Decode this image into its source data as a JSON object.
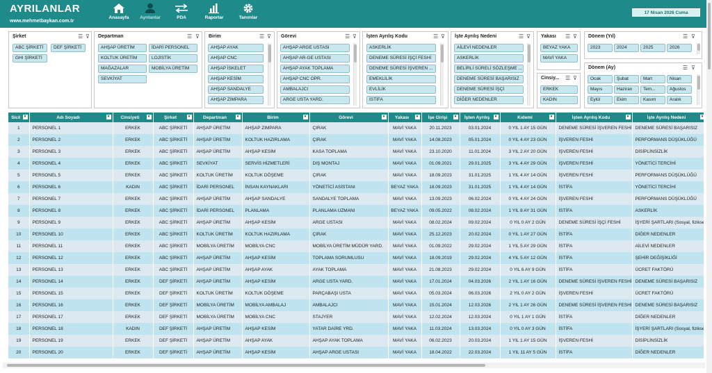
{
  "header": {
    "title": "AYRILANLAR",
    "website": "www.mehmetbaykan.com.tr",
    "date": "17 Nisan 2026 Cuma",
    "nav": [
      {
        "label": "Anasayfa",
        "icon": "home-icon"
      },
      {
        "label": "Ayrılanlar",
        "icon": "user-icon"
      },
      {
        "label": "PDA",
        "icon": "arrows-icon"
      },
      {
        "label": "Raporlar",
        "icon": "bar-chart-icon"
      },
      {
        "label": "Tanımlar",
        "icon": "gear-icon"
      }
    ]
  },
  "slicers": {
    "sirket": {
      "title": "Şirket",
      "items": [
        "ABC ŞİRKETİ",
        "DEF ŞİRKETİ",
        "GHI ŞİRKETİ"
      ]
    },
    "departman": {
      "title": "Departman",
      "items": [
        "AHŞAP ÜRETİM",
        "İDARİ PERSONEL",
        "KOLTUK ÜRETİM",
        "LOJİSTİK",
        "MAĞAZALAR",
        "MOBİLYA ÜRETİM",
        "SEVKİYAT"
      ]
    },
    "birim": {
      "title": "Birim",
      "items": [
        "AHŞAP AYAK",
        "AHŞAP CNC",
        "AHŞAP İSKELET",
        "AHŞAP KESİM",
        "AHŞAP SANDALYE",
        "AHŞAP ZIMPARA"
      ]
    },
    "gorevi": {
      "title": "Görevi",
      "items": [
        "AHŞAP ARGE USTASI",
        "AHŞAP AR-GE USTASI",
        "AHŞAP AYAK TOPLAMA",
        "AHŞAP CNC OPR.",
        "AMBALAJCI",
        "ARGE USTA YARD."
      ]
    },
    "istenAyrilisKodu": {
      "title": "İşten Ayrılış Kodu",
      "items": [
        "ASKERLİK",
        "DENEME SÜRESİ İŞÇİ FESHİ",
        "DENEME SÜRESİ İŞVEREN ...",
        "EMEKLİLİK",
        "EVLİLİK",
        "İSTİFA"
      ]
    },
    "isteAyrilisNedeni": {
      "title": "İşte Ayrılış Nedeni",
      "items": [
        "AİLEVİ NEDENLER",
        "ASKERLİK",
        "BELİRLİ SÜRELİ SÖZLEŞME ...",
        "DENEME SÜRESİ BAŞARISIZ",
        "DENEME SÜRESİ İŞÇİ",
        "DİĞER NEDENLER"
      ]
    },
    "yakasi": {
      "title": "Yakası",
      "items": [
        "BEYAZ YAKA",
        "MAVİ YAKA"
      ]
    },
    "cinsiyet": {
      "title": "Cinsiy...",
      "items": [
        "ERKEK",
        "KADIN"
      ]
    },
    "donemYil": {
      "title": "Dönem (Yıl)",
      "items": [
        "2023",
        "2024",
        "2025",
        "2026"
      ]
    },
    "donemAy": {
      "title": "Dönem (Ay)",
      "items": [
        "Ocak",
        "Şubat",
        "Mart",
        "Nisan",
        "Mayıs",
        "Haziran",
        "Tem...",
        "Ağustos",
        "Eylül",
        "Ekim",
        "Kasım",
        "Aralık"
      ]
    }
  },
  "table": {
    "columns": [
      "Sicil",
      "Adı Soyadı",
      "Cinsiyeti",
      "Şirket",
      "Departman",
      "Birim",
      "Görevi",
      "Yakası",
      "İşe Girişi",
      "İşten Ayrılış",
      "Kıdemi",
      "İşten Ayrılış Kodu",
      "İşte Ayrılış Nedeni"
    ],
    "rows": [
      [
        "1",
        "PERSONEL 1",
        "ERKEK",
        "ABC ŞİRKETİ",
        "AHŞAP ÜRETİM",
        "AHŞAP ZIMPARA",
        "ÇIRAK",
        "MAVİ YAKA",
        "20.11.2023",
        "03.01.2024",
        "0 YIL 1 AY 15 GÜN",
        "DENEME SÜRESİ İŞVEREN FESHİ",
        "DENEME SÜRESİ BAŞARISIZ"
      ],
      [
        "2",
        "PERSONEL 2",
        "ERKEK",
        "ABC ŞİRKETİ",
        "AHŞAP ÜRETİM",
        "KOLTUK HAZIRLAMA",
        "ÇIRAK",
        "MAVİ YAKA",
        "14.08.2023",
        "05.01.2024",
        "0 YIL 4 AY 23 GÜN",
        "İŞVEREN FESHİ",
        "PERFORMANS DÜŞÜKLÜĞÜ"
      ],
      [
        "3",
        "PERSONEL 3",
        "ERKEK",
        "ABC ŞİRKETİ",
        "AHŞAP ÜRETİM",
        "AHŞAP KESİM",
        "KASA TOPLAMA",
        "MAVİ YAKA",
        "23.10.2020",
        "11.01.2024",
        "3 YIL 2 AY 20 GÜN",
        "İŞVEREN FESHİ",
        "DİSİPLİNSİZLİK"
      ],
      [
        "4",
        "PERSONEL 4",
        "ERKEK",
        "ABC ŞİRKETİ",
        "SEVKİYAT",
        "SERVİS HİZMETLERİ",
        "DIŞ MONTAJ",
        "MAVİ YAKA",
        "01.09.2021",
        "29.01.2025",
        "3 YIL 4 AY 29 GÜN",
        "İŞVEREN FESHİ",
        "YÖNETİCİ TERCİHİ"
      ],
      [
        "5",
        "PERSONEL 5",
        "ERKEK",
        "ABC ŞİRKETİ",
        "KOLTUK ÜRETİM",
        "KOLTUK DÖŞEME",
        "ÇIRAK",
        "MAVİ YAKA",
        "18.09.2023",
        "31.01.2025",
        "1 YIL 4 AY 14 GÜN",
        "İŞVEREN FESHİ",
        "PERFORMANS DÜŞÜKLÜĞÜ"
      ],
      [
        "6",
        "PERSONEL 6",
        "KADIN",
        "ABC ŞİRKETİ",
        "İDARİ PERSONEL",
        "İNSAN KAYNAKLARI",
        "YÖNETİCİ ASİSTANI",
        "BEYAZ YAKA",
        "18.09.2023",
        "31.01.2025",
        "1 YIL 4 AY 14 GÜN",
        "İSTİFA",
        "YÖNETİCİ TERCİHİ"
      ],
      [
        "7",
        "PERSONEL 7",
        "ERKEK",
        "ABC ŞİRKETİ",
        "AHŞAP ÜRETİM",
        "AHŞAP SANDALYE",
        "SANDALYE TOPLAMA",
        "MAVİ YAKA",
        "13.09.2023",
        "06.02.2024",
        "0 YIL 4 AY 24 GÜN",
        "İŞVEREN FESHİ",
        "PERFORMANS DÜŞÜKLÜĞÜ"
      ],
      [
        "8",
        "PERSONEL 8",
        "ERKEK",
        "ABC ŞİRKETİ",
        "İDARİ PERSONEL",
        "PLANLAMA",
        "PLANLAMA UZMANI",
        "BEYAZ YAKA",
        "09.05.2022",
        "08.02.2024",
        "1 YIL 8 AY 31 GÜN",
        "İSTİFA",
        "ASKERLİK"
      ],
      [
        "9",
        "PERSONEL 9",
        "ERKEK",
        "ABC ŞİRKETİ",
        "AHŞAP ÜRETİM",
        "AHŞAP KESİM",
        "ARGE USTASI",
        "MAVİ YAKA",
        "08.02.2024",
        "09.02.2024",
        "0 YIL 0 AY 2 GÜN",
        "DENEME SÜRESİ İŞÇİ FESHİ",
        "İŞYERİ ŞARTLARI (Sosyal, fiziksel vb."
      ],
      [
        "10",
        "PERSONEL 10",
        "ERKEK",
        "ABC ŞİRKETİ",
        "KOLTUK ÜRETİM",
        "KOLTUK HAZIRLAMA",
        "ÇIRAK",
        "MAVİ YAKA",
        "25.12.2023",
        "20.02.2024",
        "0 YIL 1 AY 27 GÜN",
        "İSTİFA",
        "DİĞER NEDENLER"
      ],
      [
        "11",
        "PERSONEL 11",
        "ERKEK",
        "ABC ŞİRKETİ",
        "MOBİLYA ÜRETİM",
        "MOBİLYA CNC",
        "MOBİLYA ÜRETİM MÜDÜR YARD.",
        "MAVİ YAKA",
        "01.09.2022",
        "29.02.2024",
        "1 YIL 5 AY 29 GÜN",
        "İSTİFA",
        "AİLEVİ NEDENLER"
      ],
      [
        "12",
        "PERSONEL 12",
        "ERKEK",
        "ABC ŞİRKETİ",
        "AHŞAP ÜRETİM",
        "AHŞAP KESİM",
        "TOPLAMA SORUMLUSU",
        "MAVİ YAKA",
        "18.09.2019",
        "29.02.2024",
        "4 YIL 5 AY 12 GÜN",
        "İSTİFA",
        "ŞEHİR DEĞİŞİKLİĞİ"
      ],
      [
        "13",
        "PERSONEL 13",
        "ERKEK",
        "ABC ŞİRKETİ",
        "AHŞAP ÜRETİM",
        "AHŞAP AYAK",
        "AYAK TOPLAMA",
        "MAVİ YAKA",
        "21.08.2023",
        "29.02.2024",
        "0 YIL 6 AY 9 GÜN",
        "İSTİFA",
        "ÜCRET FAKTÖRÜ"
      ],
      [
        "14",
        "PERSONEL 14",
        "ERKEK",
        "DEF ŞİRKETİ",
        "AHŞAP ÜRETİM",
        "AHŞAP KESİM",
        "ARGE USTA YARD.",
        "MAVİ YAKA",
        "17.01.2024",
        "04.03.2026",
        "2 YIL 1 AY 16 GÜN",
        "DENEME SÜRESİ İŞVEREN FESHİ",
        "DENEME SÜRESİ BAŞARISIZ"
      ],
      [
        "15",
        "PERSONEL 15",
        "ERKEK",
        "DEF ŞİRKETİ",
        "KOLTUK ÜRETİM",
        "KOLTUK DÖŞEME",
        "PARÇABAŞI USTA",
        "MAVİ YAKA",
        "05.03.2024",
        "06.03.2026",
        "2 YIL 0 AY 2 GÜN",
        "İŞVEREN FESHİ",
        "ÜCRET FAKTÖRÜ"
      ],
      [
        "16",
        "PERSONEL 16",
        "ERKEK",
        "DEF ŞİRKETİ",
        "MOBİLYA ÜRETİM",
        "MOBİLYA AMBALAJ",
        "AMBALAJCI",
        "MAVİ YAKA",
        "15.01.2024",
        "12.03.2026",
        "2 YIL 1 AY 26 GÜN",
        "DENEME SÜRESİ İŞVEREN FESHİ",
        "DENEME SÜRESİ BAŞARISIZ"
      ],
      [
        "17",
        "PERSONEL 17",
        "ERKEK",
        "DEF ŞİRKETİ",
        "MOBİLYA ÜRETİM",
        "MOBİLYA CNC",
        "STAJYER",
        "MAVİ YAKA",
        "12.02.2024",
        "12.03.2024",
        "0 YIL 1 AY 1 GÜN",
        "İSTİFA",
        "DİĞER NEDENLER"
      ],
      [
        "18",
        "PERSONEL 18",
        "KADIN",
        "DEF ŞİRKETİ",
        "AHŞAP ÜRETİM",
        "AHŞAP KESİM",
        "YATAR DAİRE YRD.",
        "MAVİ YAKA",
        "11.03.2024",
        "13.03.2024",
        "0 YIL 0 AY 3 GÜN",
        "İSTİFA",
        "İŞYERİ ŞARTLARI (Sosyal, fiziksel vb."
      ],
      [
        "19",
        "PERSONEL 19",
        "ERKEK",
        "DEF ŞİRKETİ",
        "AHŞAP ÜRETİM",
        "AHŞAP AYAK",
        "AHŞAP AYAK TOPLAMA",
        "MAVİ YAKA",
        "06.02.2023",
        "20.03.2024",
        "1 YIL 1 AY 15 GÜN",
        "İŞVEREN FESHİ",
        "DİSİPLİNSİZLİK"
      ],
      [
        "20",
        "PERSONEL 20",
        "ERKEK",
        "DEF ŞİRKETİ",
        "AHŞAP ÜRETİM",
        "AHŞAP KESİM",
        "AHŞAP ARGE USTASI",
        "MAVİ YAKA",
        "18.04.2022",
        "22.03.2024",
        "1 YIL 11 AY 5 GÜN",
        "İSTİFA",
        "DİĞER NEDENLER"
      ]
    ]
  },
  "colors": {
    "accent": "#1f8a8a",
    "row_odd": "#dde9f0",
    "row_even": "#bfe3ef",
    "slicer_item": "#c9e7ef"
  }
}
